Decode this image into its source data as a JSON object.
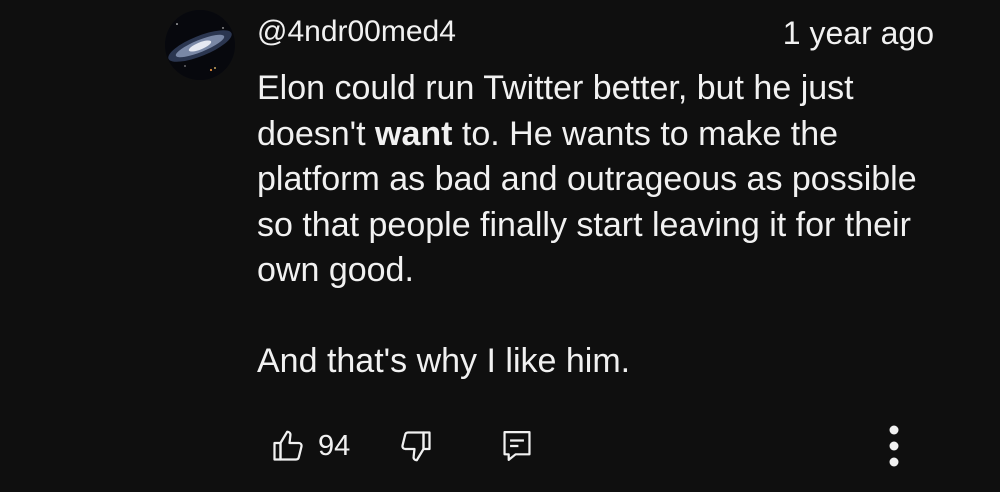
{
  "comment": {
    "author": "@4ndr00med4",
    "timestamp": "1 year ago",
    "body": {
      "p1_before": "Elon could run Twitter better, but he just doesn't ",
      "p1_bold": "want",
      "p1_after": " to. He wants to make the platform as bad and outrageous as possible so that people finally start leaving it for their own good.",
      "p2": "And that's why I like him."
    },
    "avatar_icon": "galaxy-avatar",
    "actions": {
      "like_icon": "thumbs-up-icon",
      "like_count": "94",
      "dislike_icon": "thumbs-down-icon",
      "reply_icon": "reply-comment-icon",
      "more_icon": "more-vertical-icon"
    },
    "colors": {
      "background": "#0f0f0f",
      "text": "#f1f1f1"
    }
  }
}
